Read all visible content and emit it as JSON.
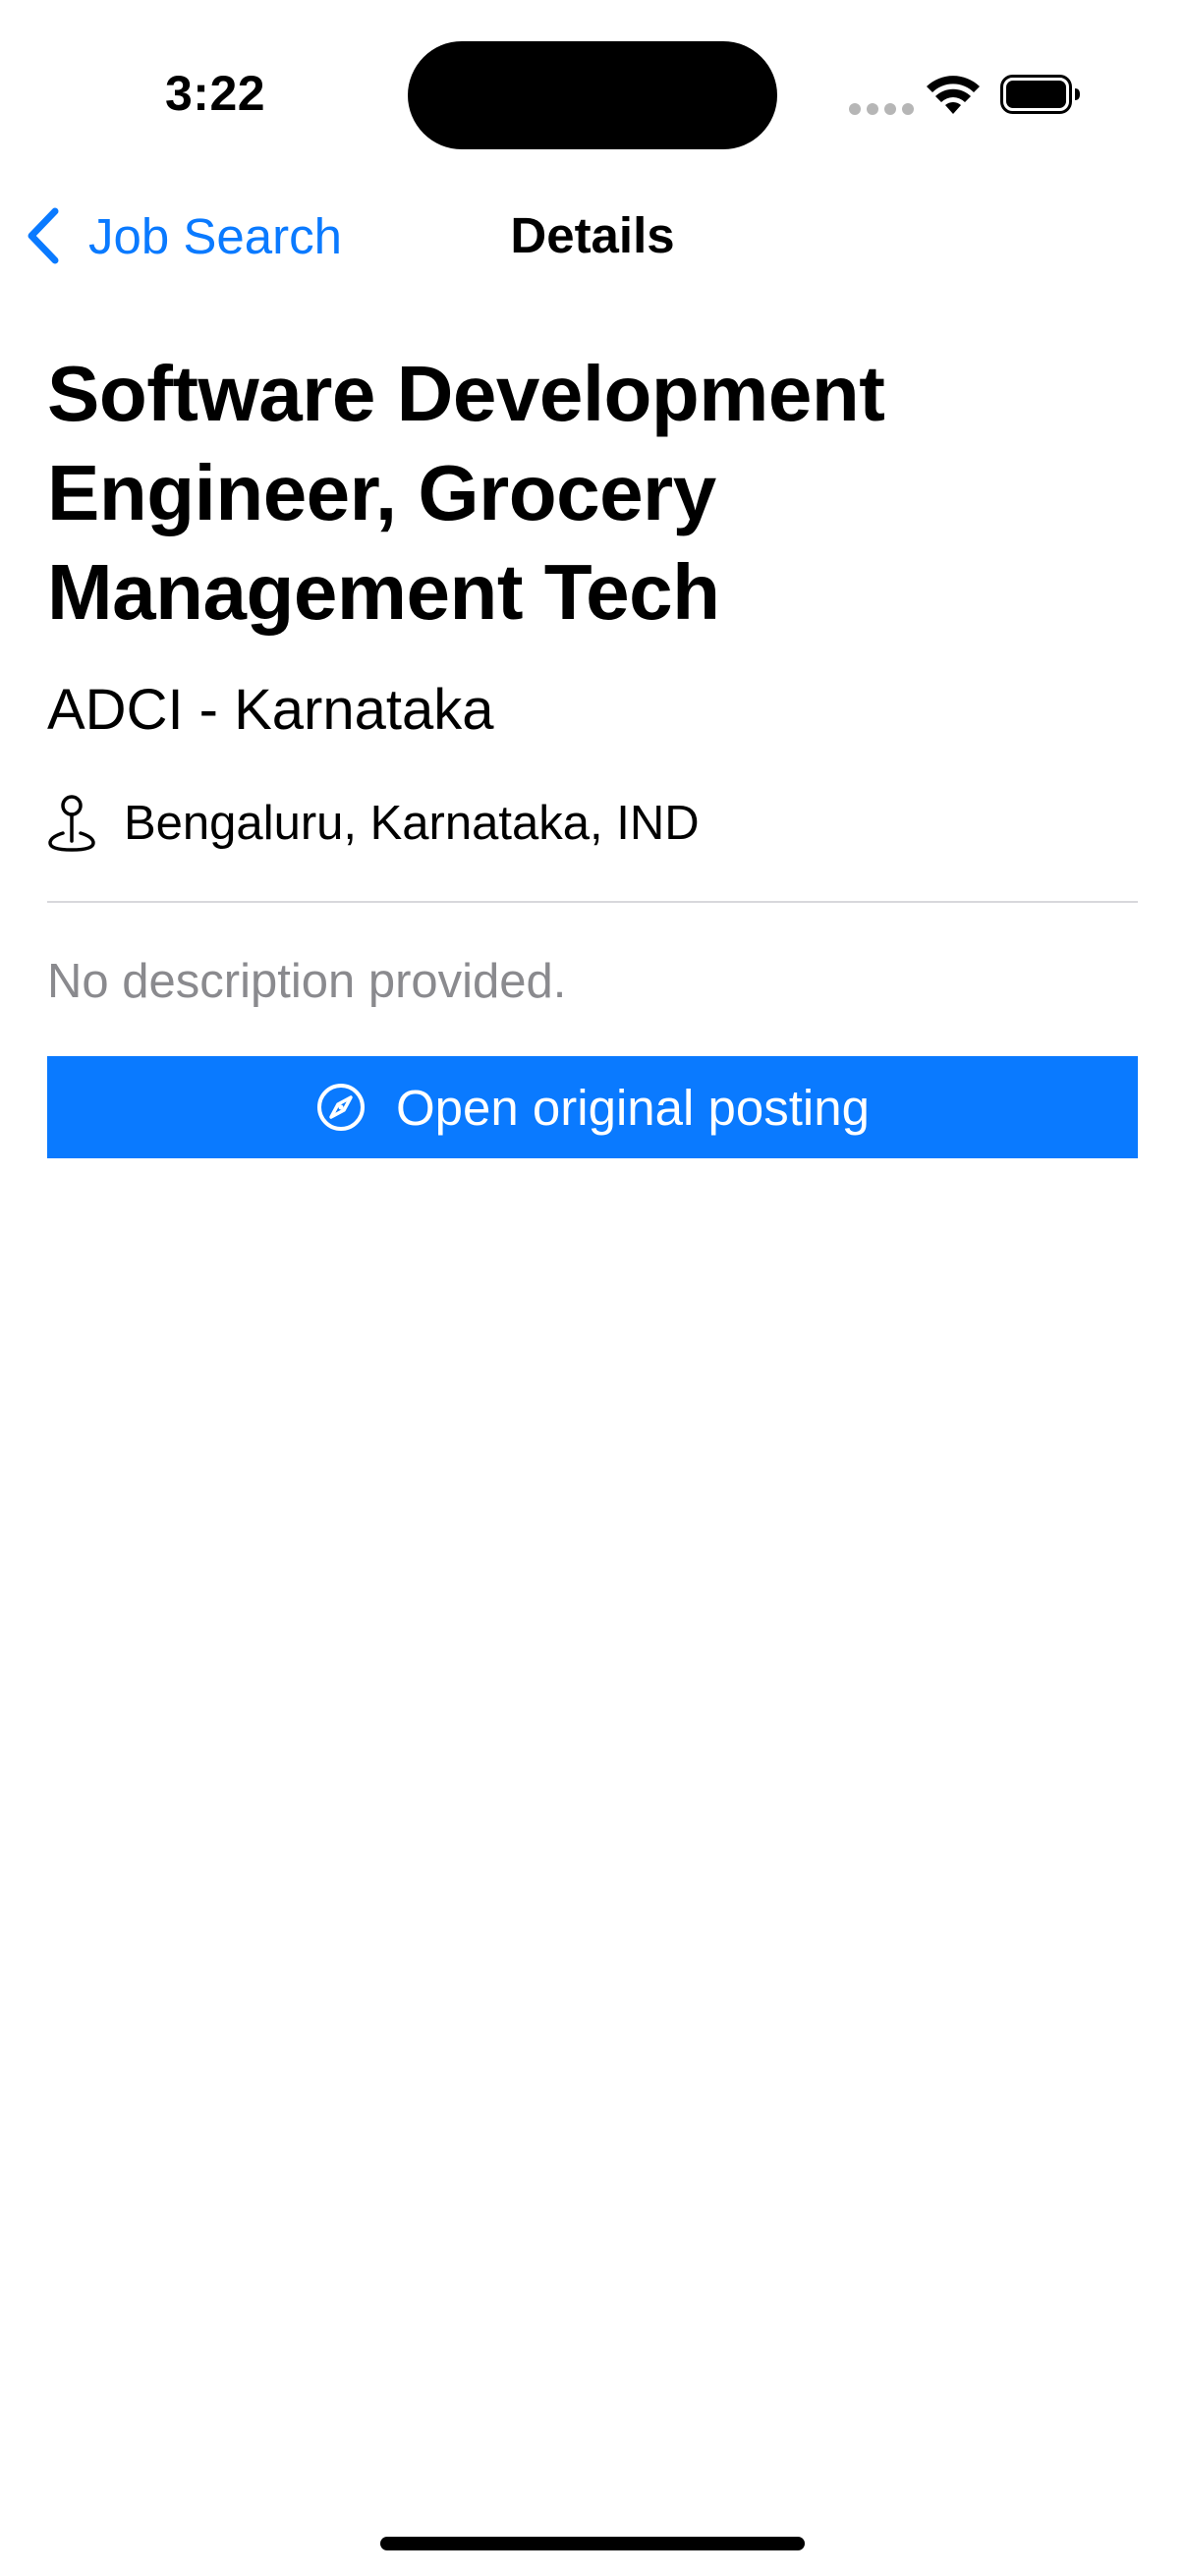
{
  "status_bar": {
    "time": "3:22"
  },
  "nav": {
    "back_label": "Job Search",
    "title": "Details"
  },
  "job": {
    "title": "Software Development Engineer, Grocery Management Tech",
    "company": "ADCI - Karnataka",
    "location": "Bengaluru, Karnataka, IND",
    "description": "No description provided.",
    "open_button_label": "Open original posting"
  },
  "icons": {
    "back": "chevron-left-icon",
    "location": "map-pin-icon",
    "open": "compass-icon",
    "wifi": "wifi-icon",
    "battery": "battery-icon"
  },
  "colors": {
    "accent": "#0a7aff",
    "secondary_text": "#8a8a8e",
    "divider": "#d8d8dc"
  }
}
